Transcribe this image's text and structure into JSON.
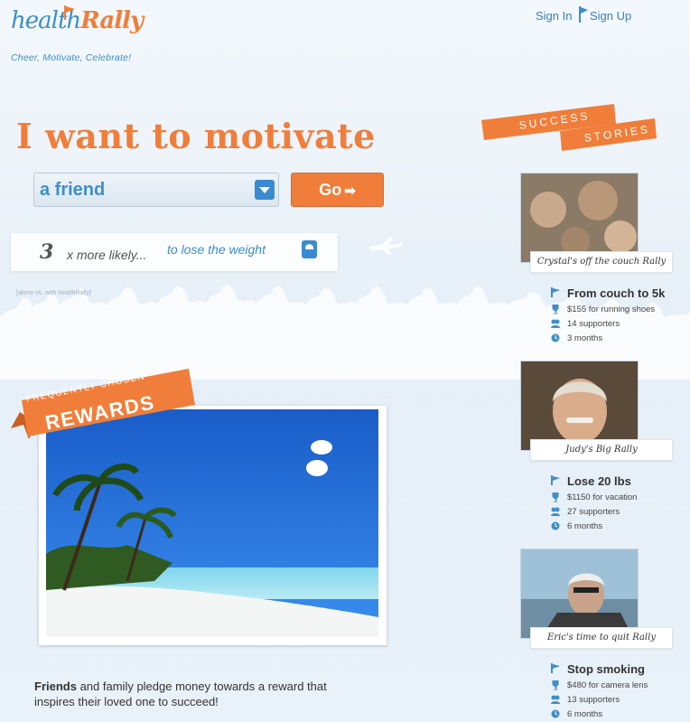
{
  "brand": {
    "logo_health": "health",
    "logo_rally": "Rally",
    "tagline": "Cheer, Motivate, Celebrate!"
  },
  "nav": {
    "sign_in": "Sign In",
    "sign_up": "Sign Up"
  },
  "hero": {
    "headline": "I want to motivate",
    "selected_recipient": "a friend",
    "go_label": "Go",
    "likely_multiplier": "3",
    "likely_text": "x more likely...",
    "likely_goal": "to lose the weight",
    "footnote": "[alone vs. with healthRally]"
  },
  "rewards": {
    "ribbon_top": "FREQUENTLY CHOSEN",
    "ribbon_main": "REWARDS",
    "pledge_bold": "Friends",
    "pledge_rest": " and family pledge money towards a reward that inspires their loved one to succeed!"
  },
  "success": {
    "ribbon_top": "SUCCESS",
    "ribbon_bottom": "STORIES",
    "stories": [
      {
        "caption": "Crystal's off the couch Rally",
        "goal": "From couch to 5k",
        "reward": "$155 for running shoes",
        "supporters": "14 supporters",
        "duration": "3 months"
      },
      {
        "caption": "Judy's Big Rally",
        "goal": "Lose 20 lbs",
        "reward": "$1150 for vacation",
        "supporters": "27 supporters",
        "duration": "6 months"
      },
      {
        "caption": "Eric's time to quit Rally",
        "goal": "Stop smoking",
        "reward": "$480 for camera lens",
        "supporters": "13 supporters",
        "duration": "6 months"
      }
    ]
  },
  "colors": {
    "orange": "#f07e3a",
    "blue": "#3d8ec9",
    "background": "#e9f1f9"
  },
  "icons": [
    "flag-icon",
    "dropdown-arrow-icon",
    "arrow-right-icon",
    "scale-icon",
    "airplane-icon",
    "goal-flag-icon",
    "reward-trophy-icon",
    "supporters-icon",
    "clock-icon"
  ]
}
